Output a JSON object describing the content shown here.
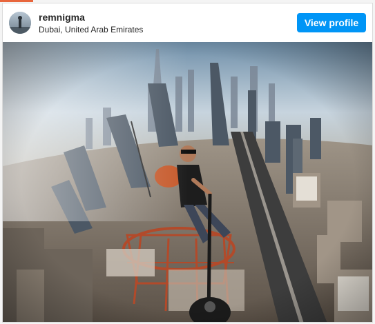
{
  "post": {
    "username": "remnigma",
    "location": "Dubai, United Arab Emirates",
    "view_profile_label": "View profile"
  },
  "colors": {
    "accent_strip": "#e8663d",
    "button": "#0095f6",
    "text": "#262626"
  },
  "icons": {
    "avatar": "profile-avatar",
    "photo": "post-photo"
  }
}
